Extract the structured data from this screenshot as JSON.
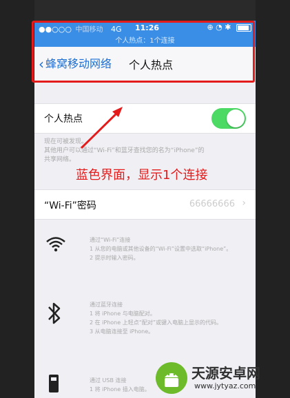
{
  "status_bar": {
    "carrier": "中国移动",
    "network": "4G",
    "time": "11:26"
  },
  "hotspot_banner": "个人热点：1个连接",
  "navbar": {
    "back_label": "蜂窝移动网络",
    "title": "个人热点"
  },
  "hotspot_toggle": {
    "label": "个人热点",
    "on": true
  },
  "discoverable_hint": "现在可被发现。\n其他用户可以通过“Wi-Fi”和蓝牙查找您的名为“iPhone”的共享网络。",
  "wifi_password": {
    "label": "“Wi-Fi”密码",
    "value": "66666666"
  },
  "instructions": {
    "wifi": "通过“Wi-Fi”连接\n1 从您的电脑或其他设备的“Wi-Fi”设置中选取“iPhone”。\n2 提示时输入密码。",
    "bluetooth": "通过蓝牙连接\n1 将 iPhone 与电脑配对。\n2 在 iPhone 上轻点“配对”或键入电脑上显示的代码。\n3 从电脑连接至 iPhone。",
    "usb": "通过 USB 连接\n1 将 iPhone 插入电脑。"
  },
  "annotation": {
    "callout": "蓝色界面，显示1个连接",
    "color": "#e41b1b"
  },
  "watermark": {
    "title": "天源安卓网",
    "url": "www.jytyaz.com"
  },
  "colors": {
    "status_blue": "#3a8ee6",
    "ios_blue": "#1a6fd6",
    "toggle_green": "#4cd964"
  }
}
